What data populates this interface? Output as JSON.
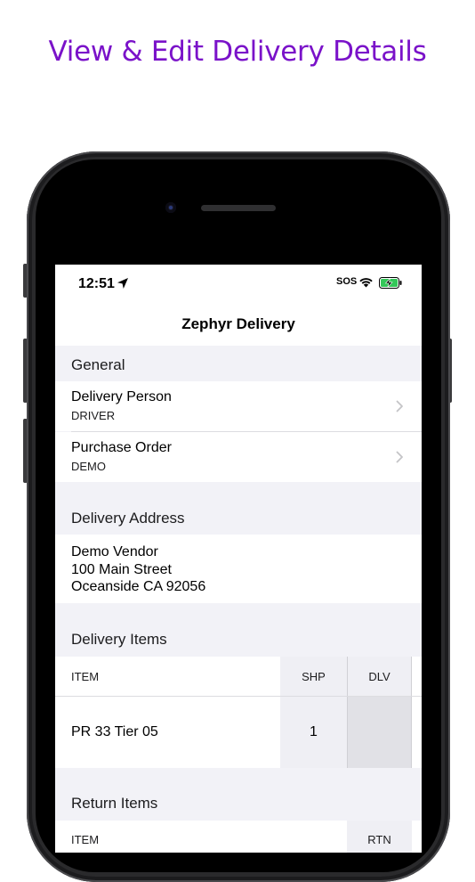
{
  "headline": "View & Edit Delivery Details",
  "status_bar": {
    "time": "12:51",
    "carrier": "SOS",
    "icons": [
      "location-arrow-icon",
      "wifi-icon",
      "battery-charging-icon"
    ]
  },
  "nav": {
    "title": "Zephyr Delivery"
  },
  "general": {
    "header": "General",
    "rows": [
      {
        "title": "Delivery Person",
        "value": "DRIVER"
      },
      {
        "title": "Purchase Order",
        "value": "DEMO"
      }
    ]
  },
  "delivery_address": {
    "header": "Delivery Address",
    "lines": [
      "Demo Vendor",
      "100 Main Street",
      "Oceanside CA 92056"
    ]
  },
  "delivery_items": {
    "header": "Delivery Items",
    "columns": [
      "ITEM",
      "SHP",
      "DLV"
    ],
    "rows": [
      {
        "item": "PR 33 Tier 05",
        "shp": "1",
        "dlv": ""
      }
    ]
  },
  "return_items": {
    "header": "Return Items",
    "columns": [
      "ITEM",
      "RTN"
    ]
  },
  "colors": {
    "headline": "#7a12c9",
    "grouped_bg": "#f2f2f7",
    "battery_green": "#34c759"
  }
}
